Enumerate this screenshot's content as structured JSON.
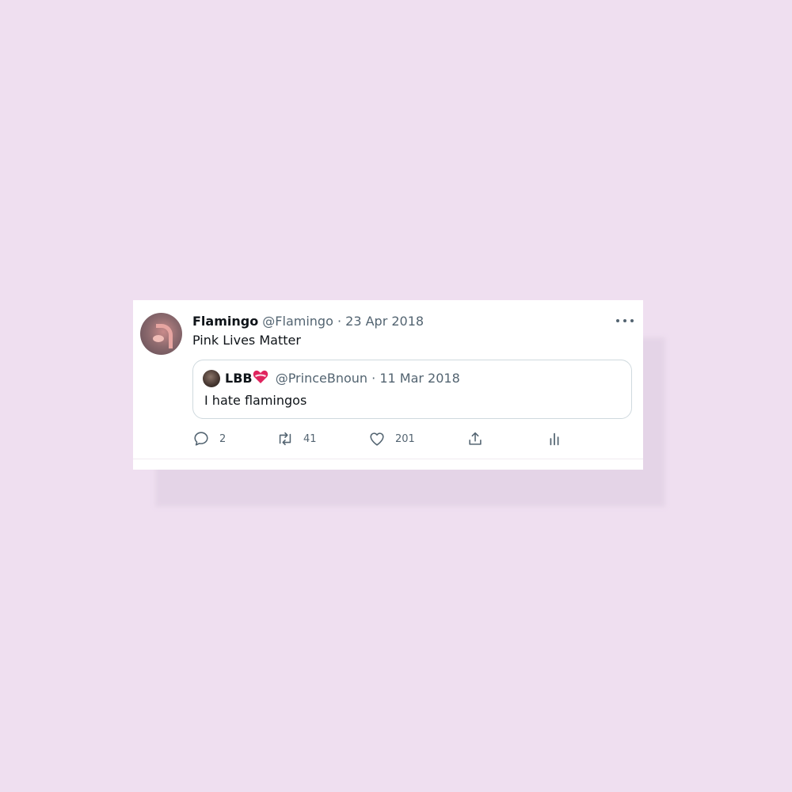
{
  "tweet": {
    "display_name": "Flamingo",
    "handle": "@Flamingo",
    "separator": "·",
    "date": "23 Apr 2018",
    "text": "Pink Lives Matter",
    "quoted": {
      "display_name": "LBB",
      "emoji": "heart-emoji",
      "handle": "@PrinceBnoun",
      "separator": "·",
      "date": "11 Mar 2018",
      "text": "I hate flamingos"
    },
    "actions": {
      "replies": "2",
      "retweets": "41",
      "likes": "201"
    }
  },
  "colors": {
    "background": "#efdff0",
    "card": "#ffffff",
    "text_primary": "#0f1419",
    "text_secondary": "#536471",
    "border": "#cfd9de"
  }
}
